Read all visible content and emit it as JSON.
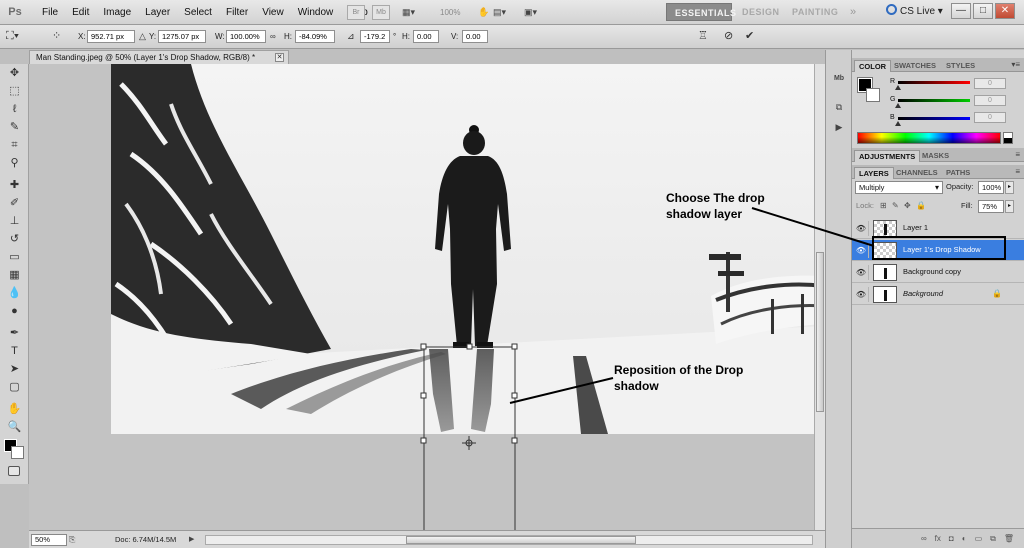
{
  "app": {
    "logo": "Ps",
    "menus": [
      "File",
      "Edit",
      "Image",
      "Layer",
      "Select",
      "Filter",
      "View",
      "Window",
      "Help"
    ],
    "bridge_label": "Br",
    "minibridge_label": "Mb",
    "zoom_readout": "100%",
    "workspaces": [
      "ESSENTIALS",
      "DESIGN",
      "PAINTING"
    ],
    "workspace_more": "»",
    "cs_live": "CS Live",
    "window_controls": [
      "—",
      "□",
      "✕"
    ]
  },
  "options_bar": {
    "x_label": "X:",
    "x_value": "952.71 px",
    "y_label": "Y:",
    "y_value": "1275.07 px",
    "w_label": "W:",
    "w_value": "100.00%",
    "h_label": "H:",
    "h_value": "-84.09%",
    "angle_value": "-179.2",
    "hskew_label": "H:",
    "hskew_value": "0.00",
    "vskew_label": "V:",
    "vskew_value": "0.00"
  },
  "document": {
    "tab_title": "Man Standing.jpeg @ 50% (Layer 1's Drop Shadow, RGB/8) *",
    "zoom": "50%",
    "doc_size": "Doc: 6.74M/14.5M"
  },
  "panels": {
    "color_tabs": [
      "COLOR",
      "SWATCHES",
      "STYLES"
    ],
    "color_channels": [
      {
        "label": "R",
        "value": "0",
        "color": "#cc0000"
      },
      {
        "label": "G",
        "value": "0",
        "color": "#00a000"
      },
      {
        "label": "B",
        "value": "0",
        "color": "#0000cc"
      }
    ],
    "adjust_tabs": [
      "ADJUSTMENTS",
      "MASKS"
    ],
    "layers_tabs": [
      "LAYERS",
      "CHANNELS",
      "PATHS"
    ],
    "blend_mode": "Multiply",
    "opacity_label": "Opacity:",
    "opacity_value": "100%",
    "lock_label": "Lock:",
    "fill_label": "Fill:",
    "fill_value": "75%",
    "layers": [
      {
        "name": "Layer 1",
        "selected": false
      },
      {
        "name": "Layer 1's Drop Shadow",
        "selected": true
      },
      {
        "name": "Background copy",
        "selected": false
      },
      {
        "name": "Background",
        "selected": false
      }
    ]
  },
  "annotations": {
    "choose_layer": "Choose The drop shadow layer",
    "reposition": "Reposition of the Drop shadow"
  },
  "accent_color": "#3a7ee0"
}
